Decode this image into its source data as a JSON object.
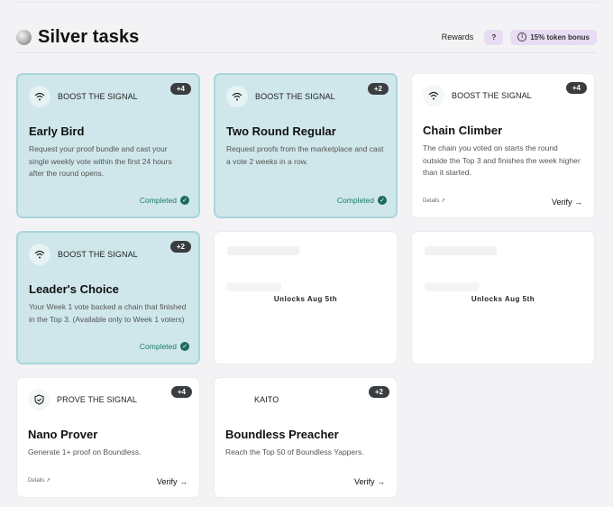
{
  "header": {
    "title": "Silver tasks",
    "rewards_label": "Rewards",
    "help_label": "?",
    "bonus_label": "15% token bonus"
  },
  "tasks": [
    {
      "category": "BOOST THE SIGNAL",
      "points": "+4",
      "name": "Early Bird",
      "description": "Request your proof bundle and cast your single weekly vote within the first 24 hours after the round opens.",
      "status": "Completed"
    },
    {
      "category": "BOOST THE SIGNAL",
      "points": "+2",
      "name": "Two Round Regular",
      "description": "Request proofs from the marketplace and cast a vote 2 weeks in a row.",
      "status": "Completed"
    },
    {
      "category": "BOOST THE SIGNAL",
      "points": "+4",
      "name": "Chain Climber",
      "description": "The chain you voted on starts the round outside the Top 3 and finishes the week higher than it started.",
      "details": "Details",
      "action": "Verify"
    },
    {
      "category": "BOOST THE SIGNAL",
      "points": "+2",
      "name": "Leader's Choice",
      "description": "Your Week 1 vote backed a chain that finished in the Top 3. (Available only to Week 1 voters)",
      "status": "Completed"
    },
    {
      "locked_label": "Unlocks Aug 5th"
    },
    {
      "locked_label": "Unlocks Aug 5th"
    },
    {
      "category": "PROVE THE SIGNAL",
      "points": "+4",
      "name": "Nano Prover",
      "description": "Generate 1+ proof on Boundless.",
      "details": "Details",
      "action": "Verify"
    },
    {
      "category": "KAITO",
      "points": "+2",
      "name": "Boundless Preacher",
      "description": "Reach the Top 50 of Boundless Yappers.",
      "action": "Verify"
    }
  ],
  "icons": {
    "signal": "wifi-signal-icon",
    "shield": "shield-check-icon",
    "check": "check-circle-icon",
    "arrow": "arrow-right-icon",
    "external": "external-link-icon"
  },
  "colors": {
    "completed_bg": "#cfe7ea",
    "completed_text": "#1d7a6a",
    "badge_bg": "#3a3d40",
    "bonus_bg": "#e7dcf3"
  }
}
